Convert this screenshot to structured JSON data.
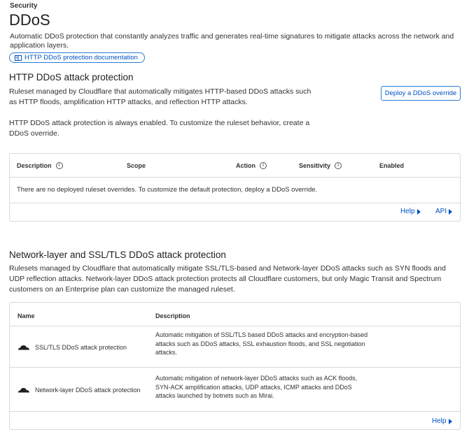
{
  "breadcrumb": "Security",
  "title": "DDoS",
  "intro": "Automatic DDoS protection that constantly analyzes traffic and generates real-time signatures to mitigate attacks across the network and application layers.",
  "doc_link": {
    "icon": "book-icon",
    "label": "HTTP DDoS protection documentation"
  },
  "http": {
    "heading": "HTTP DDoS attack protection",
    "desc": "Ruleset managed by Cloudflare that automatically mitigates HTTP-based DDoS attacks such as HTTP floods, amplification HTTP attacks, and reflection HTTP attacks.",
    "note": "HTTP DDoS attack protection is always enabled. To customize the ruleset behavior, create a DDoS override.",
    "deploy_button": "Deploy a DDoS override",
    "columns": [
      "Description",
      "Scope",
      "Action",
      "Sensitivity",
      "Enabled"
    ],
    "empty": "There are no deployed ruleset overrides. To customize the default protection, deploy a DDoS override.",
    "help": "Help",
    "api": "API"
  },
  "network": {
    "heading": "Network-layer and SSL/TLS DDoS attack protection",
    "desc": "Rulesets managed by Cloudflare that automatically mitigate SSL/TLS-based and Network-layer DDoS attacks such as SYN floods and UDP reflection attacks. Network-layer DDoS attack protection protects all Cloudflare customers, but only Magic Transit and Spectrum customers on an Enterprise plan can customize the managed ruleset.",
    "columns": [
      "Name",
      "Description"
    ],
    "rows": [
      {
        "icon": "cloudflare-cloud-icon",
        "name": "SSL/TLS DDoS attack protection",
        "description": "Automatic mitigation of SSL/TLS based DDoS attacks and encryption-based attacks such as DDoS attacks, SSL exhaustion floods, and SSL negotiation attacks."
      },
      {
        "icon": "cloudflare-cloud-icon",
        "name": "Network-layer DDoS attack protection",
        "description": "Automatic mitigation of network-layer DDoS attacks such as ACK floods, SYN-ACK amplification attacks, UDP attacks, ICMP attacks and DDoS attacks launched by botnets such as Mirai."
      }
    ],
    "help": "Help"
  }
}
